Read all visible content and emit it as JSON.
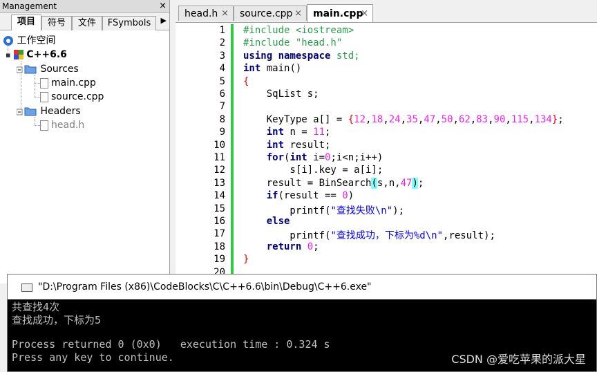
{
  "management": {
    "title": "Management",
    "close": "×",
    "tabs": [
      "项目",
      "符号",
      "文件",
      "FSymbols"
    ],
    "more": "▶"
  },
  "tree": {
    "workspace": "工作空间",
    "project": "C++6.6",
    "sources": "Sources",
    "files_sources": [
      "main.cpp",
      "source.cpp"
    ],
    "headers": "Headers",
    "files_headers": [
      "head.h"
    ]
  },
  "editor_tabs": [
    {
      "label": "head.h",
      "close": "×"
    },
    {
      "label": "source.cpp",
      "close": "×"
    },
    {
      "label": "main.cpp",
      "close": "×"
    }
  ],
  "line_numbers": [
    "1",
    "2",
    "3",
    "4",
    "5",
    "6",
    "7",
    "8",
    "9",
    "10",
    "11",
    "12",
    "13",
    "14",
    "15",
    "16",
    "17",
    "18",
    "19",
    "20"
  ],
  "console": {
    "title": "\"D:\\Program Files (x86)\\CodeBlocks\\C\\C++6.6\\bin\\Debug\\C++6.exe\"",
    "lines": [
      "共查找4次",
      "查找成功，下标为5",
      "",
      "Process returned 0 (0x0)   execution time : 0.324 s",
      "Press any key to continue."
    ]
  },
  "watermark": "CSDN @爱吃苹果的派大星",
  "colors": {
    "preprocessor": "#2a9d4a",
    "keyword": "#00007f",
    "number": "#f020f0",
    "string": "#0000ff",
    "brace": "#ff0000",
    "change_bar": "#2ecc40",
    "brace_highlight": "#80ffff"
  }
}
